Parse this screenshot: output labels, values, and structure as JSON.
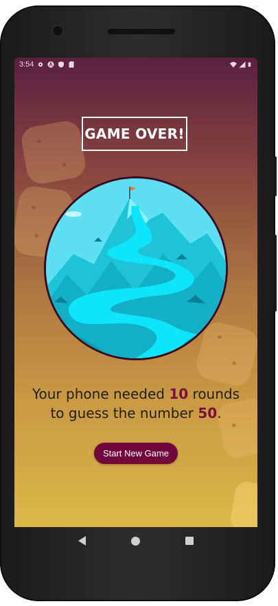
{
  "status_bar": {
    "time": "3:54",
    "left_icons": [
      "gear-icon",
      "a-icon",
      "shield-icon",
      "sd-card-icon"
    ],
    "right_icons": [
      "wifi-icon",
      "cell-signal-icon",
      "battery-icon"
    ]
  },
  "game_over": {
    "title": "GAME OVER!",
    "summary_part1": "Your phone needed ",
    "rounds": "10",
    "summary_part2": " rounds",
    "summary_part3": "to guess the number ",
    "number": "50",
    "summary_end": ".",
    "image_icon": "mountain-summit-flag-illustration",
    "start_button_label": "Start New Game"
  },
  "colors": {
    "accent": "#72063c",
    "highlight": "#7a0f3d",
    "gradient_top": "#5b2040",
    "gradient_bottom": "#dcb84a"
  },
  "nav_bar": {
    "icons": [
      "back-icon",
      "home-icon",
      "recents-icon"
    ]
  }
}
